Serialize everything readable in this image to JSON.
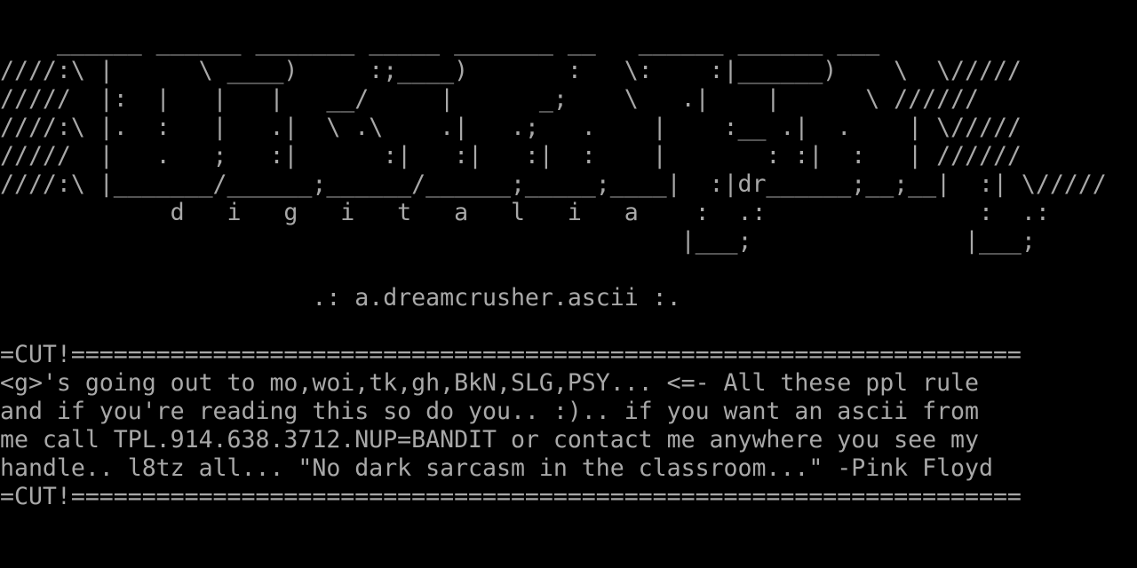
{
  "terminal": {
    "background": "#000000",
    "foreground": "#a8a8a8",
    "lines": [
      "    ______ ______ _______ _____ _______ __   ______ ______ ___",
      "////:\\ |      \\ ____)     :;____)       :   \\:    :|______)    \\  \\/////",
      "/////  |:  |   |   |   __/     |      _;    \\   .|    |      \\ //////",
      "////:\\ |.  :   |   .|  \\ .\\    .|   .;   .    |    :__ .|  .    | \\/////",
      "/////  |   .   ;   :|      :|   :|   :|  :    |       : :|  :   | //////",
      "////:\\ |_______/______;______/______;_____;____|  :|dr______;__;__|  :| \\/////",
      "            d   i   g   i   t   a   l   i   a    :  .:               :  .:",
      "                                                |___;               |___;",
      "",
      "                      .: a.dreamcrusher.ascii :.",
      "",
      "=CUT!===================================================================",
      "<g>'s going out to mo,woi,tk,gh,BkN,SLG,PSY... <=- All these ppl rule",
      "and if you're reading this so do you.. :).. if you want an ascii from",
      "me call TPL.914.638.3712.NUP=BANDIT or contact me anywhere you see my",
      "handle.. l8tz all... \"No dark sarcasm in the classroom...\" -Pink Floyd",
      "=CUT!==================================================================="
    ]
  }
}
